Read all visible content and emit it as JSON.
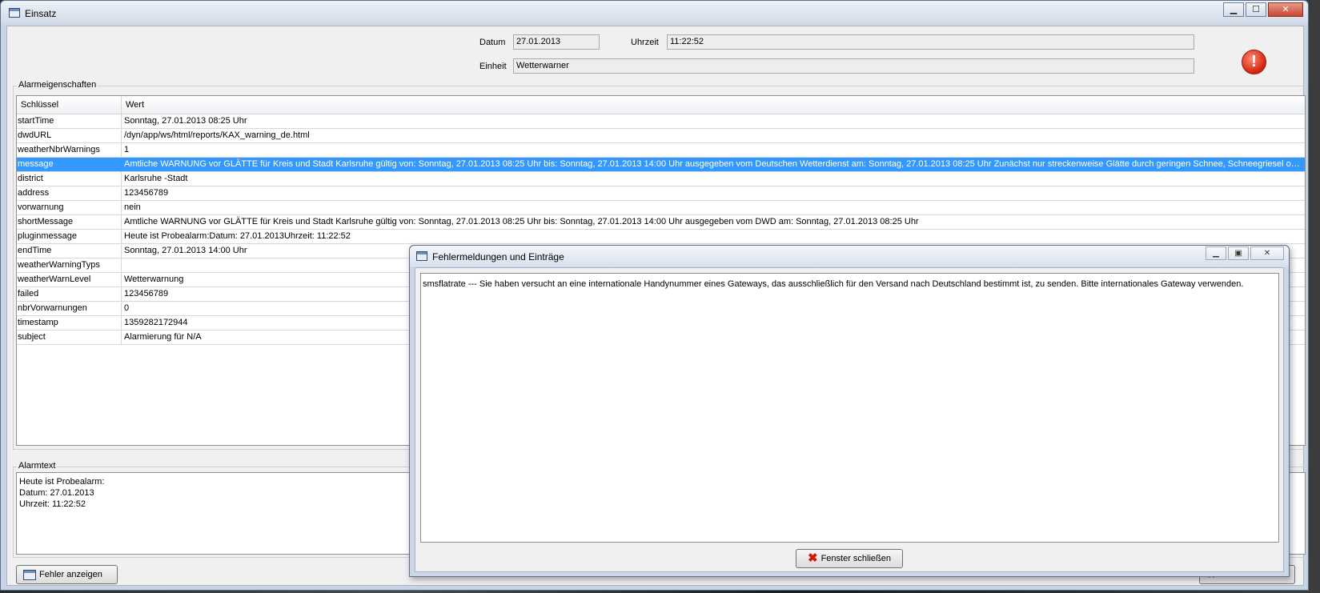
{
  "window": {
    "title": "Einsatz",
    "controls": {
      "minimize": "▁",
      "maximize": "☐",
      "close": "✕"
    }
  },
  "header": {
    "datum_label": "Datum",
    "datum_value": "27.01.2013",
    "uhrzeit_label": "Uhrzeit",
    "uhrzeit_value": "11:22:52",
    "einheit_label": "Einheit",
    "einheit_value": "Wetterwarner",
    "error_icon": "!"
  },
  "alarm_properties": {
    "group_title": "Alarmeigenschaften",
    "columns": [
      "Schlüssel",
      "Wert"
    ],
    "selected_row": 3,
    "rows": [
      {
        "key": "startTime",
        "value": "Sonntag, 27.01.2013 08:25 Uhr"
      },
      {
        "key": "dwdURL",
        "value": "/dyn/app/ws/html/reports/KAX_warning_de.html"
      },
      {
        "key": "weatherNbrWarnings",
        "value": "1"
      },
      {
        "key": "message",
        "value": "Amtliche WARNUNG vor GLÄTTE für Kreis und Stadt Karlsruhe gültig von: Sonntag, 27.01.2013 08:25 Uhr bis: Sonntag, 27.01.2013 14:00 Uhr ausgegeben vom Deutschen Wetterdienst am: Sonntag, 27.01.2013 08:25 Uhr Zunächst nur streckenweise Glätte durch geringen Schnee, Schneegriesel oder gef..."
      },
      {
        "key": "district",
        "value": "Karlsruhe -Stadt"
      },
      {
        "key": "address",
        "value": "123456789"
      },
      {
        "key": "vorwarnung",
        "value": "nein"
      },
      {
        "key": "shortMessage",
        "value": "Amtliche WARNUNG vor GLÄTTE für Kreis und Stadt Karlsruhe gültig von: Sonntag, 27.01.2013 08:25 Uhr bis: Sonntag, 27.01.2013 14:00 Uhr ausgegeben vom DWD am: Sonntag, 27.01.2013 08:25 Uhr"
      },
      {
        "key": "pluginmessage",
        "value": "Heute ist Probealarm:Datum: 27.01.2013Uhrzeit: 11:22:52"
      },
      {
        "key": "endTime",
        "value": "Sonntag, 27.01.2013 14:00 Uhr"
      },
      {
        "key": "weatherWarningTyps",
        "value": ""
      },
      {
        "key": "weatherWarnLevel",
        "value": "Wetterwarnung"
      },
      {
        "key": "failed",
        "value": "123456789"
      },
      {
        "key": "nbrVorwarnungen",
        "value": "0"
      },
      {
        "key": "timestamp",
        "value": "1359282172944"
      },
      {
        "key": "subject",
        "value": "Alarmierung für N/A"
      }
    ]
  },
  "alarmtext": {
    "group_title": "Alarmtext",
    "lines": [
      "Heute ist Probealarm:",
      "Datum: 27.01.2013",
      "Uhrzeit: 11:22:52"
    ]
  },
  "buttons": {
    "show_errors": "Fehler anzeigen"
  },
  "error_dialog": {
    "title": "Fehlermeldungen und Einträge",
    "message": "smsflatrate --- Sie haben versucht an eine internationale Handynummer eines Gateways, das ausschließlich für den Versand nach Deutschland bestimmt ist, zu senden. Bitte internationales Gateway verwenden.",
    "close_button": "Fenster schließen",
    "controls": {
      "minimize": "▁",
      "maximize": "▣",
      "close": "✕"
    }
  },
  "colors": {
    "selection": "#3399ff",
    "error_red": "#d0220f"
  }
}
